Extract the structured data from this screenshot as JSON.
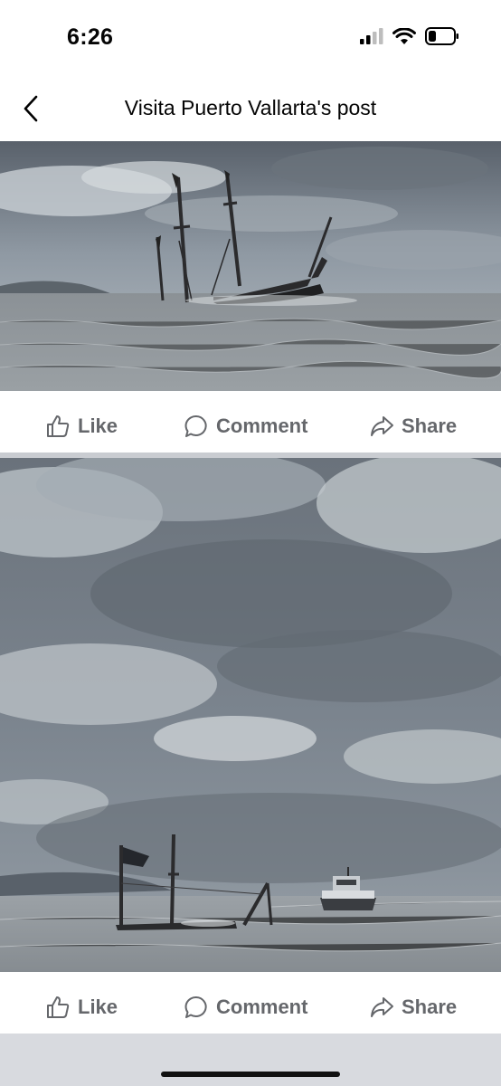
{
  "status_bar": {
    "time": "6:26",
    "icons": [
      "cellular-signal-icon",
      "wifi-icon",
      "battery-icon"
    ]
  },
  "header": {
    "title": "Visita Puerto Vallarta's post",
    "back_icon": "chevron-left-icon"
  },
  "posts": [
    {
      "image_description_icon": "photo",
      "actions": {
        "like": "Like",
        "comment": "Comment",
        "share": "Share"
      }
    },
    {
      "image_description_icon": "photo",
      "actions": {
        "like": "Like",
        "comment": "Comment",
        "share": "Share"
      }
    }
  ],
  "colors": {
    "action_text": "#65676b",
    "separator": "#c9ccd1",
    "bottom_bar": "#d8dadf"
  }
}
